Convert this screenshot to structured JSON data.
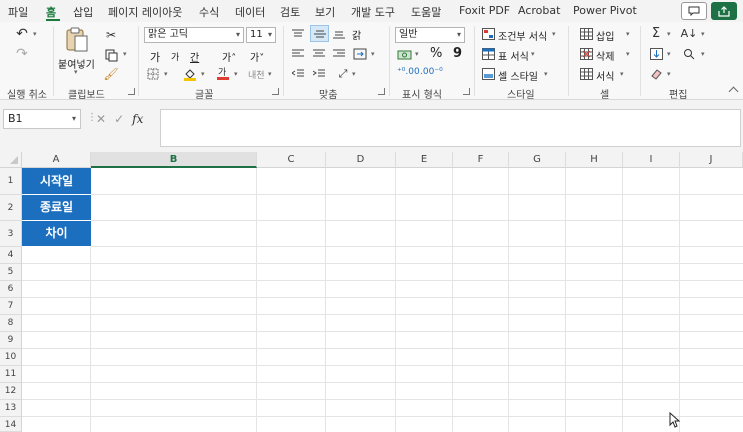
{
  "menu": {
    "tabs": [
      "파일",
      "홈",
      "삽입",
      "페이지 레이아웃",
      "수식",
      "데이터",
      "검토",
      "보기",
      "개발 도구",
      "도움말",
      "Foxit PDF",
      "Acrobat",
      "Power Pivot"
    ],
    "active_tab": "홈"
  },
  "ribbon": {
    "groups": {
      "undo": "실행 취소",
      "clipboard": "클립보드",
      "font": "글꼴",
      "alignment": "맞춤",
      "number": "표시 형식",
      "styles": "스타일",
      "cells": "셀",
      "editing": "편집"
    },
    "paste_label": "붙여넣기",
    "font_name": "맑은 고딕",
    "font_size": "11",
    "number_format": "일반",
    "conditional_format": "조건부 서식",
    "format_as_table": "표 서식",
    "cell_styles": "셀 스타일",
    "insert": "삽입",
    "delete": "삭제",
    "format": "서식",
    "font_glyphs": {
      "inc": "가",
      "dec": "가",
      "bold": "가",
      "italic": "가",
      "underline": "간",
      "font_color": "가",
      "phonetic": "내천"
    },
    "wrap_text": "갉",
    "percent": "%",
    "comma": "9"
  },
  "formula_bar": {
    "name_box": "B1",
    "cancel": "✕",
    "enter": "✓",
    "fx": "fx",
    "value": ""
  },
  "sheet": {
    "columns": [
      "A",
      "B",
      "C",
      "D",
      "E",
      "F",
      "G",
      "H",
      "I",
      "J"
    ],
    "rows": [
      "1",
      "2",
      "3",
      "4",
      "5",
      "6",
      "7",
      "8",
      "9",
      "10",
      "11",
      "12",
      "13",
      "14"
    ],
    "selected_column": "B",
    "cells": {
      "A1": "시작일",
      "A2": "종료일",
      "A3": "차이"
    },
    "label_color": "#1c6fbe"
  },
  "colors": {
    "accent": "#1e7145",
    "header_fill": "#1c6fbe"
  }
}
